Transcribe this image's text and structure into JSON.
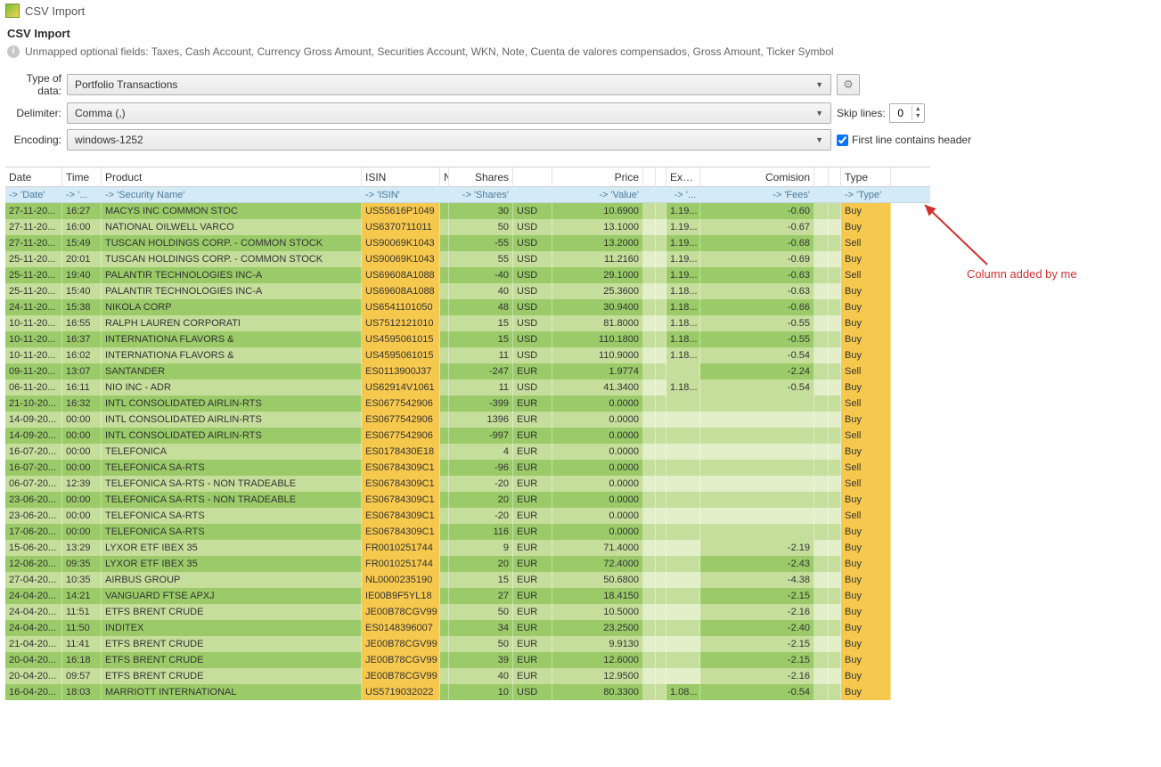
{
  "window": {
    "title": "CSV Import"
  },
  "header": {
    "page_title": "CSV Import",
    "unmapped_label": "Unmapped optional fields: Taxes, Cash Account, Currency Gross Amount, Securities Account, WKN, Note, Cuenta de valores compensados, Gross Amount, Ticker Symbol"
  },
  "form": {
    "type_label": "Type of data:",
    "type_value": "Portfolio Transactions",
    "delimiter_label": "Delimiter:",
    "delimiter_value": "Comma (,)",
    "encoding_label": "Encoding:",
    "encoding_value": "windows-1252",
    "skip_label": "Skip lines:",
    "skip_value": "0",
    "first_line_label": "First line contains header"
  },
  "table": {
    "headers": [
      "Date",
      "Time",
      "Product",
      "ISIN",
      "N",
      "Shares",
      "",
      "Price",
      "",
      "",
      "Exc...",
      "Comision",
      "",
      "",
      "Type"
    ],
    "mapping": [
      "-> 'Date'",
      "-> '...",
      "-> 'Security Name'",
      "-> 'ISIN'",
      "",
      "-> 'Shares'",
      "",
      "-> 'Value'",
      "",
      "",
      "-> '...",
      "-> 'Fees'",
      "",
      "",
      "-> 'Type'"
    ],
    "rows": [
      {
        "date": "27-11-20...",
        "time": "16:27",
        "product": "MACYS INC COMMON STOC",
        "isin": "US55616P1049",
        "shares": "30",
        "ccy": "USD",
        "price": "10.6900",
        "exc": "1.19...",
        "comm": "-0.60",
        "type": "Buy",
        "alt": 0
      },
      {
        "date": "27-11-20...",
        "time": "16:00",
        "product": "NATIONAL OILWELL VARCO",
        "isin": "US6370711011",
        "shares": "50",
        "ccy": "USD",
        "price": "13.1000",
        "exc": "1.19...",
        "comm": "-0.67",
        "type": "Buy",
        "alt": 1
      },
      {
        "date": "27-11-20...",
        "time": "15:49",
        "product": "TUSCAN HOLDINGS CORP. - COMMON STOCK",
        "isin": "US90069K1043",
        "shares": "-55",
        "ccy": "USD",
        "price": "13.2000",
        "exc": "1.19...",
        "comm": "-0.68",
        "type": "Sell",
        "alt": 0
      },
      {
        "date": "25-11-20...",
        "time": "20:01",
        "product": "TUSCAN HOLDINGS CORP. - COMMON STOCK",
        "isin": "US90069K1043",
        "shares": "55",
        "ccy": "USD",
        "price": "11.2160",
        "exc": "1.19...",
        "comm": "-0.69",
        "type": "Buy",
        "alt": 1
      },
      {
        "date": "25-11-20...",
        "time": "19:40",
        "product": "PALANTIR TECHNOLOGIES INC-A",
        "isin": "US69608A1088",
        "shares": "-40",
        "ccy": "USD",
        "price": "29.1000",
        "exc": "1.19...",
        "comm": "-0.63",
        "type": "Sell",
        "alt": 0
      },
      {
        "date": "25-11-20...",
        "time": "15:40",
        "product": "PALANTIR TECHNOLOGIES INC-A",
        "isin": "US69608A1088",
        "shares": "40",
        "ccy": "USD",
        "price": "25.3600",
        "exc": "1.18...",
        "comm": "-0.63",
        "type": "Buy",
        "alt": 1
      },
      {
        "date": "24-11-20...",
        "time": "15:38",
        "product": "NIKOLA CORP",
        "isin": "US6541101050",
        "shares": "48",
        "ccy": "USD",
        "price": "30.9400",
        "exc": "1.18...",
        "comm": "-0.66",
        "type": "Buy",
        "alt": 0
      },
      {
        "date": "10-11-20...",
        "time": "16:55",
        "product": "RALPH LAUREN CORPORATI",
        "isin": "US7512121010",
        "shares": "15",
        "ccy": "USD",
        "price": "81.8000",
        "exc": "1.18...",
        "comm": "-0.55",
        "type": "Buy",
        "alt": 1
      },
      {
        "date": "10-11-20...",
        "time": "16:37",
        "product": "INTERNATIONA FLAVORS &",
        "isin": "US4595061015",
        "shares": "15",
        "ccy": "USD",
        "price": "110.1800",
        "exc": "1.18...",
        "comm": "-0.55",
        "type": "Buy",
        "alt": 0
      },
      {
        "date": "10-11-20...",
        "time": "16:02",
        "product": "INTERNATIONA FLAVORS &",
        "isin": "US4595061015",
        "shares": "11",
        "ccy": "USD",
        "price": "110.9000",
        "exc": "1.18...",
        "comm": "-0.54",
        "type": "Buy",
        "alt": 1
      },
      {
        "date": "09-11-20...",
        "time": "13:07",
        "product": "SANTANDER",
        "isin": "ES0113900J37",
        "shares": "-247",
        "ccy": "EUR",
        "price": "1.9774",
        "exc": "",
        "comm": "-2.24",
        "type": "Sell",
        "alt": 0
      },
      {
        "date": "06-11-20...",
        "time": "16:11",
        "product": "NIO INC - ADR",
        "isin": "US62914V1061",
        "shares": "11",
        "ccy": "USD",
        "price": "41.3400",
        "exc": "1.18...",
        "comm": "-0.54",
        "type": "Buy",
        "alt": 1
      },
      {
        "date": "21-10-20...",
        "time": "16:32",
        "product": "INTL CONSOLIDATED AIRLIN-RTS",
        "isin": "ES0677542906",
        "shares": "-399",
        "ccy": "EUR",
        "price": "0.0000",
        "exc": "",
        "comm": "",
        "type": "Sell",
        "alt": 0,
        "emptycomm": true
      },
      {
        "date": "14-09-20...",
        "time": "00:00",
        "product": "INTL CONSOLIDATED AIRLIN-RTS",
        "isin": "ES0677542906",
        "shares": "1396",
        "ccy": "EUR",
        "price": "0.0000",
        "exc": "",
        "comm": "",
        "type": "Buy",
        "alt": 1,
        "emptycomm": true
      },
      {
        "date": "14-09-20...",
        "time": "00:00",
        "product": "INTL CONSOLIDATED AIRLIN-RTS",
        "isin": "ES0677542906",
        "shares": "-997",
        "ccy": "EUR",
        "price": "0.0000",
        "exc": "",
        "comm": "",
        "type": "Sell",
        "alt": 0,
        "emptycomm": true
      },
      {
        "date": "16-07-20...",
        "time": "00:00",
        "product": "TELEFONICA",
        "isin": "ES0178430E18",
        "shares": "4",
        "ccy": "EUR",
        "price": "0.0000",
        "exc": "",
        "comm": "",
        "type": "Buy",
        "alt": 1,
        "emptycomm": true
      },
      {
        "date": "16-07-20...",
        "time": "00:00",
        "product": "TELEFONICA SA-RTS",
        "isin": "ES06784309C1",
        "shares": "-96",
        "ccy": "EUR",
        "price": "0.0000",
        "exc": "",
        "comm": "",
        "type": "Sell",
        "alt": 0,
        "emptycomm": true
      },
      {
        "date": "06-07-20...",
        "time": "12:39",
        "product": "TELEFONICA SA-RTS - NON TRADEABLE",
        "isin": "ES06784309C1",
        "shares": "-20",
        "ccy": "EUR",
        "price": "0.0000",
        "exc": "",
        "comm": "",
        "type": "Sell",
        "alt": 1,
        "emptycomm": true
      },
      {
        "date": "23-06-20...",
        "time": "00:00",
        "product": "TELEFONICA SA-RTS - NON TRADEABLE",
        "isin": "ES06784309C1",
        "shares": "20",
        "ccy": "EUR",
        "price": "0.0000",
        "exc": "",
        "comm": "",
        "type": "Buy",
        "alt": 0,
        "emptycomm": true
      },
      {
        "date": "23-06-20...",
        "time": "00:00",
        "product": "TELEFONICA SA-RTS",
        "isin": "ES06784309C1",
        "shares": "-20",
        "ccy": "EUR",
        "price": "0.0000",
        "exc": "",
        "comm": "",
        "type": "Sell",
        "alt": 1,
        "emptycomm": true
      },
      {
        "date": "17-06-20...",
        "time": "00:00",
        "product": "TELEFONICA SA-RTS",
        "isin": "ES06784309C1",
        "shares": "116",
        "ccy": "EUR",
        "price": "0.0000",
        "exc": "",
        "comm": "",
        "type": "Buy",
        "alt": 0,
        "emptycomm": true
      },
      {
        "date": "15-06-20...",
        "time": "13:29",
        "product": "LYXOR ETF IBEX 35",
        "isin": "FR0010251744",
        "shares": "9",
        "ccy": "EUR",
        "price": "71.4000",
        "exc": "",
        "comm": "-2.19",
        "type": "Buy",
        "alt": 1
      },
      {
        "date": "12-06-20...",
        "time": "09:35",
        "product": "LYXOR ETF IBEX 35",
        "isin": "FR0010251744",
        "shares": "20",
        "ccy": "EUR",
        "price": "72.4000",
        "exc": "",
        "comm": "-2.43",
        "type": "Buy",
        "alt": 0
      },
      {
        "date": "27-04-20...",
        "time": "10:35",
        "product": "AIRBUS GROUP",
        "isin": "NL0000235190",
        "shares": "15",
        "ccy": "EUR",
        "price": "50.6800",
        "exc": "",
        "comm": "-4.38",
        "type": "Buy",
        "alt": 1
      },
      {
        "date": "24-04-20...",
        "time": "14:21",
        "product": "VANGUARD FTSE APXJ",
        "isin": "IE00B9F5YL18",
        "shares": "27",
        "ccy": "EUR",
        "price": "18.4150",
        "exc": "",
        "comm": "-2.15",
        "type": "Buy",
        "alt": 0
      },
      {
        "date": "24-04-20...",
        "time": "11:51",
        "product": "ETFS BRENT CRUDE",
        "isin": "JE00B78CGV99",
        "shares": "50",
        "ccy": "EUR",
        "price": "10.5000",
        "exc": "",
        "comm": "-2.16",
        "type": "Buy",
        "alt": 1
      },
      {
        "date": "24-04-20...",
        "time": "11:50",
        "product": "INDITEX",
        "isin": "ES0148396007",
        "shares": "34",
        "ccy": "EUR",
        "price": "23.2500",
        "exc": "",
        "comm": "-2.40",
        "type": "Buy",
        "alt": 0
      },
      {
        "date": "21-04-20...",
        "time": "11:41",
        "product": "ETFS BRENT CRUDE",
        "isin": "JE00B78CGV99",
        "shares": "50",
        "ccy": "EUR",
        "price": "9.9130",
        "exc": "",
        "comm": "-2.15",
        "type": "Buy",
        "alt": 1
      },
      {
        "date": "20-04-20...",
        "time": "16:18",
        "product": "ETFS BRENT CRUDE",
        "isin": "JE00B78CGV99",
        "shares": "39",
        "ccy": "EUR",
        "price": "12.6000",
        "exc": "",
        "comm": "-2.15",
        "type": "Buy",
        "alt": 0
      },
      {
        "date": "20-04-20...",
        "time": "09:57",
        "product": "ETFS BRENT CRUDE",
        "isin": "JE00B78CGV99",
        "shares": "40",
        "ccy": "EUR",
        "price": "12.9500",
        "exc": "",
        "comm": "-2.16",
        "type": "Buy",
        "alt": 1
      },
      {
        "date": "16-04-20...",
        "time": "18:03",
        "product": "MARRIOTT INTERNATIONAL",
        "isin": "US5719032022",
        "shares": "10",
        "ccy": "USD",
        "price": "80.3300",
        "exc": "1.08...",
        "comm": "-0.54",
        "type": "Buy",
        "alt": 0
      }
    ]
  },
  "annotation": {
    "text": "Column added by me"
  }
}
